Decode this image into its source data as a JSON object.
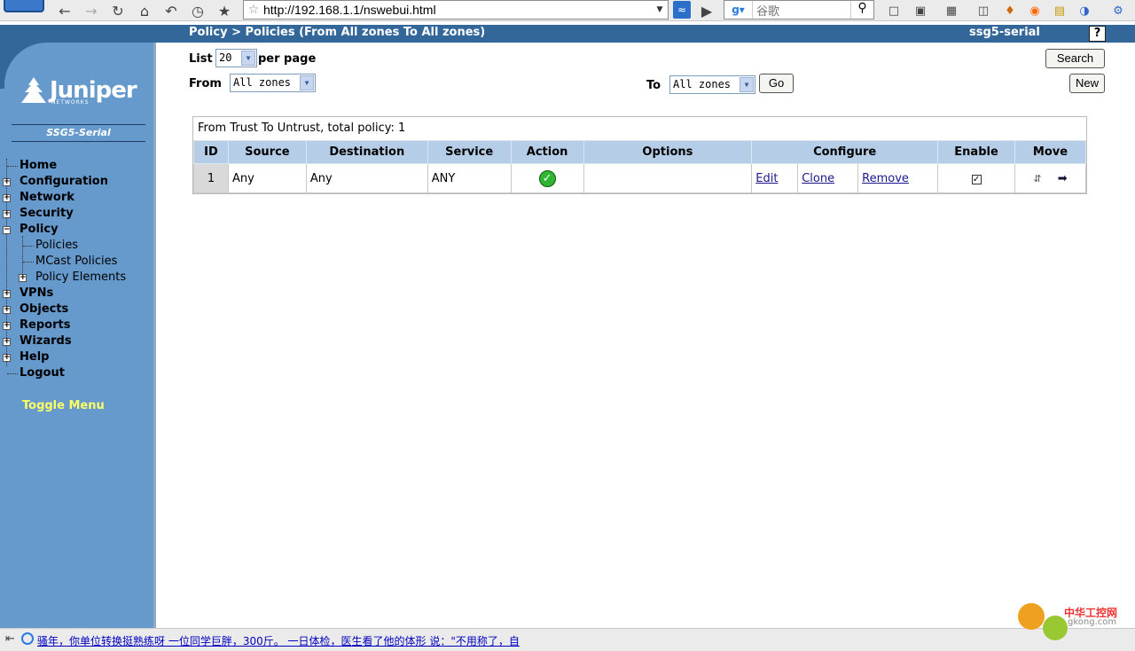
{
  "browser": {
    "url": "http://192.168.1.1/nswebui.html",
    "search_placeholder": "谷歌",
    "status_message": "骚年，你单位转换挺熟练呀 一位同学巨胖，300斤。 一日体检，医生看了他的体形 说：\"不用称了，自"
  },
  "header": {
    "breadcrumb": "Policy > Policies (From All zones To All zones)",
    "device_name": "ssg5-serial",
    "help_label": "?"
  },
  "sidebar": {
    "brand": "Juniper",
    "brand_sub": "NETWORKS",
    "model": "SSG5-Serial",
    "menu": [
      {
        "label": "Home"
      },
      {
        "label": "Configuration"
      },
      {
        "label": "Network"
      },
      {
        "label": "Security"
      },
      {
        "label": "Policy"
      },
      {
        "label": "Policies"
      },
      {
        "label": "MCast Policies"
      },
      {
        "label": "Policy Elements"
      },
      {
        "label": "VPNs"
      },
      {
        "label": "Objects"
      },
      {
        "label": "Reports"
      },
      {
        "label": "Wizards"
      },
      {
        "label": "Help"
      },
      {
        "label": "Logout"
      }
    ],
    "toggle_menu": "Toggle Menu"
  },
  "controls": {
    "list_label": "List",
    "list_value": "20",
    "per_page_label": "per page",
    "from_label": "From",
    "from_value": "All zones",
    "to_label": "To",
    "to_value": "All zones",
    "go_label": "Go",
    "search_label": "Search",
    "new_label": "New"
  },
  "policy_table": {
    "caption": "From Trust To Untrust, total policy: 1",
    "columns": [
      "ID",
      "Source",
      "Destination",
      "Service",
      "Action",
      "Options",
      "Configure",
      "Enable",
      "Move"
    ],
    "rows": [
      {
        "id": "1",
        "source": "Any",
        "destination": "Any",
        "service": "ANY",
        "action": "permit",
        "options": "",
        "edit": "Edit",
        "clone": "Clone",
        "remove": "Remove",
        "enabled": true
      }
    ]
  },
  "colors": {
    "header_bar": "#336699",
    "sidebar": "#6699cc",
    "table_header": "#b5cde6",
    "toggle_menu": "#ffff66"
  }
}
